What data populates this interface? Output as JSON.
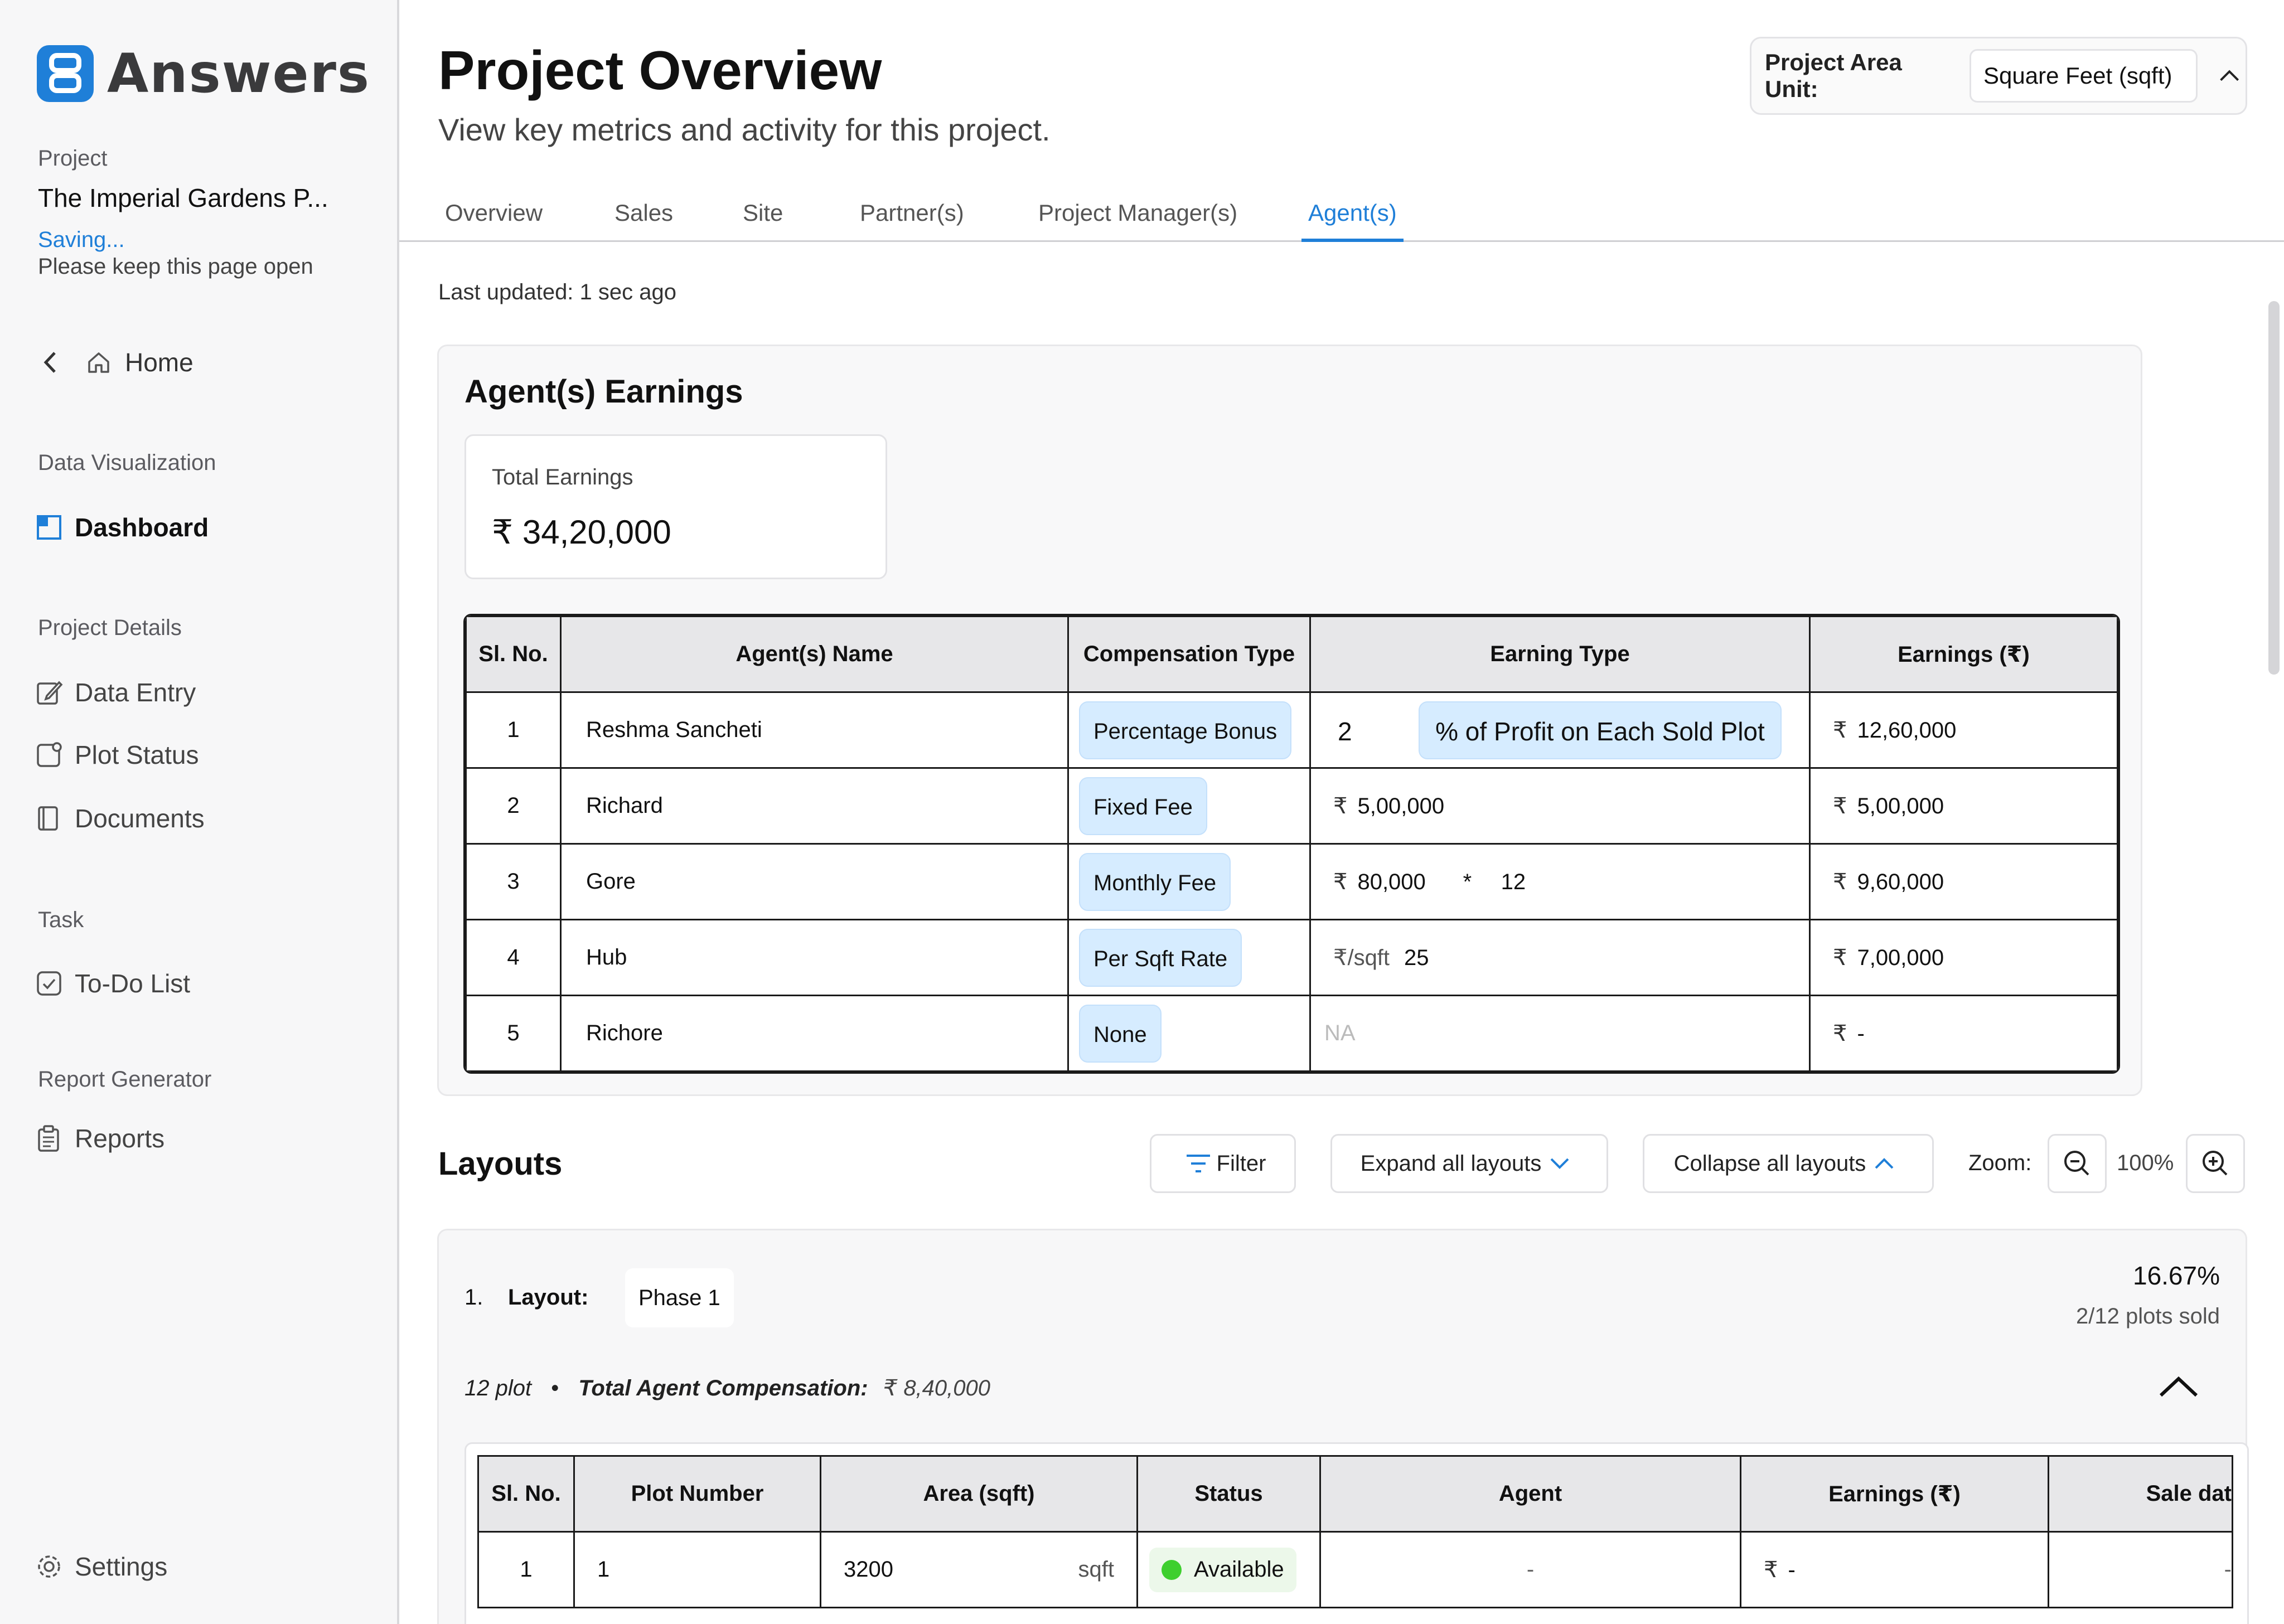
{
  "brand": {
    "name": "Answers",
    "accent": "#1f7fd8"
  },
  "sidebar": {
    "project_label": "Project",
    "project_name": "The Imperial Gardens P...",
    "saving": "Saving...",
    "keep_open": "Please keep this page open",
    "home": "Home",
    "sections": {
      "data_viz": "Data Visualization",
      "project_details": "Project Details",
      "task": "Task",
      "report_generator": "Report Generator"
    },
    "items": {
      "dashboard": "Dashboard",
      "data_entry": "Data Entry",
      "plot_status": "Plot Status",
      "documents": "Documents",
      "todo": "To-Do List",
      "reports": "Reports",
      "settings": "Settings"
    }
  },
  "header": {
    "title": "Project Overview",
    "subtitle": "View key metrics and activity for this project.",
    "unit_label": "Project Area Unit:",
    "unit_value": "Square Feet (sqft)"
  },
  "tabs": [
    "Overview",
    "Sales",
    "Site",
    "Partner(s)",
    "Project Manager(s)",
    "Agent(s)"
  ],
  "active_tab": "Agent(s)",
  "last_updated": "Last updated: 1 sec ago",
  "earnings": {
    "title": "Agent(s) Earnings",
    "total_label": "Total Earnings",
    "total_value": "₹  34,20,000",
    "currency": "₹",
    "columns": [
      "Sl. No.",
      "Agent(s) Name",
      "Compensation Type",
      "Earning Type",
      "Earnings (₹)"
    ],
    "rows": [
      {
        "sl": "1",
        "name": "Reshma Sancheti",
        "comp": "Percentage Bonus",
        "et_a": "2",
        "et_b": "% of Profit on Each Sold Plot",
        "earn": "12,60,000"
      },
      {
        "sl": "2",
        "name": "Richard",
        "comp": "Fixed Fee",
        "et_a": "₹",
        "et_b": "5,00,000",
        "earn": "5,00,000"
      },
      {
        "sl": "3",
        "name": "Gore",
        "comp": "Monthly Fee",
        "et_a": "₹",
        "et_b": "80,000",
        "et_c": "*",
        "et_d": "12",
        "earn": "9,60,000"
      },
      {
        "sl": "4",
        "name": "Hub",
        "comp": "Per Sqft Rate",
        "et_a": "₹/sqft",
        "et_b": "25",
        "earn": "7,00,000"
      },
      {
        "sl": "5",
        "name": "Richore",
        "comp": "None",
        "et_a": "NA",
        "earn": "-"
      }
    ]
  },
  "layouts": {
    "title": "Layouts",
    "filter": "Filter",
    "expand_all": "Expand all layouts",
    "collapse_all": "Collapse all layouts",
    "zoom_label": "Zoom:",
    "zoom_value": "100%",
    "items": [
      {
        "num": "1.",
        "layout_label": "Layout:",
        "name": "Phase 1",
        "percent": "16.67%",
        "sold": "2/12 plots sold",
        "plot_count": "12 plot",
        "bullet": "•",
        "comp_label": "Total Agent Compensation:",
        "comp_value": "₹  8,40,000",
        "columns": [
          "Sl. No.",
          "Plot Number",
          "Area (sqft)",
          "Status",
          "Agent",
          "Earnings (₹)",
          "Sale dat"
        ],
        "rows": [
          {
            "sl": "1",
            "plot": "1",
            "area": "3200",
            "unit": "sqft",
            "status": "Available",
            "agent": "-",
            "earn": "-",
            "sale": "-"
          }
        ]
      }
    ]
  }
}
